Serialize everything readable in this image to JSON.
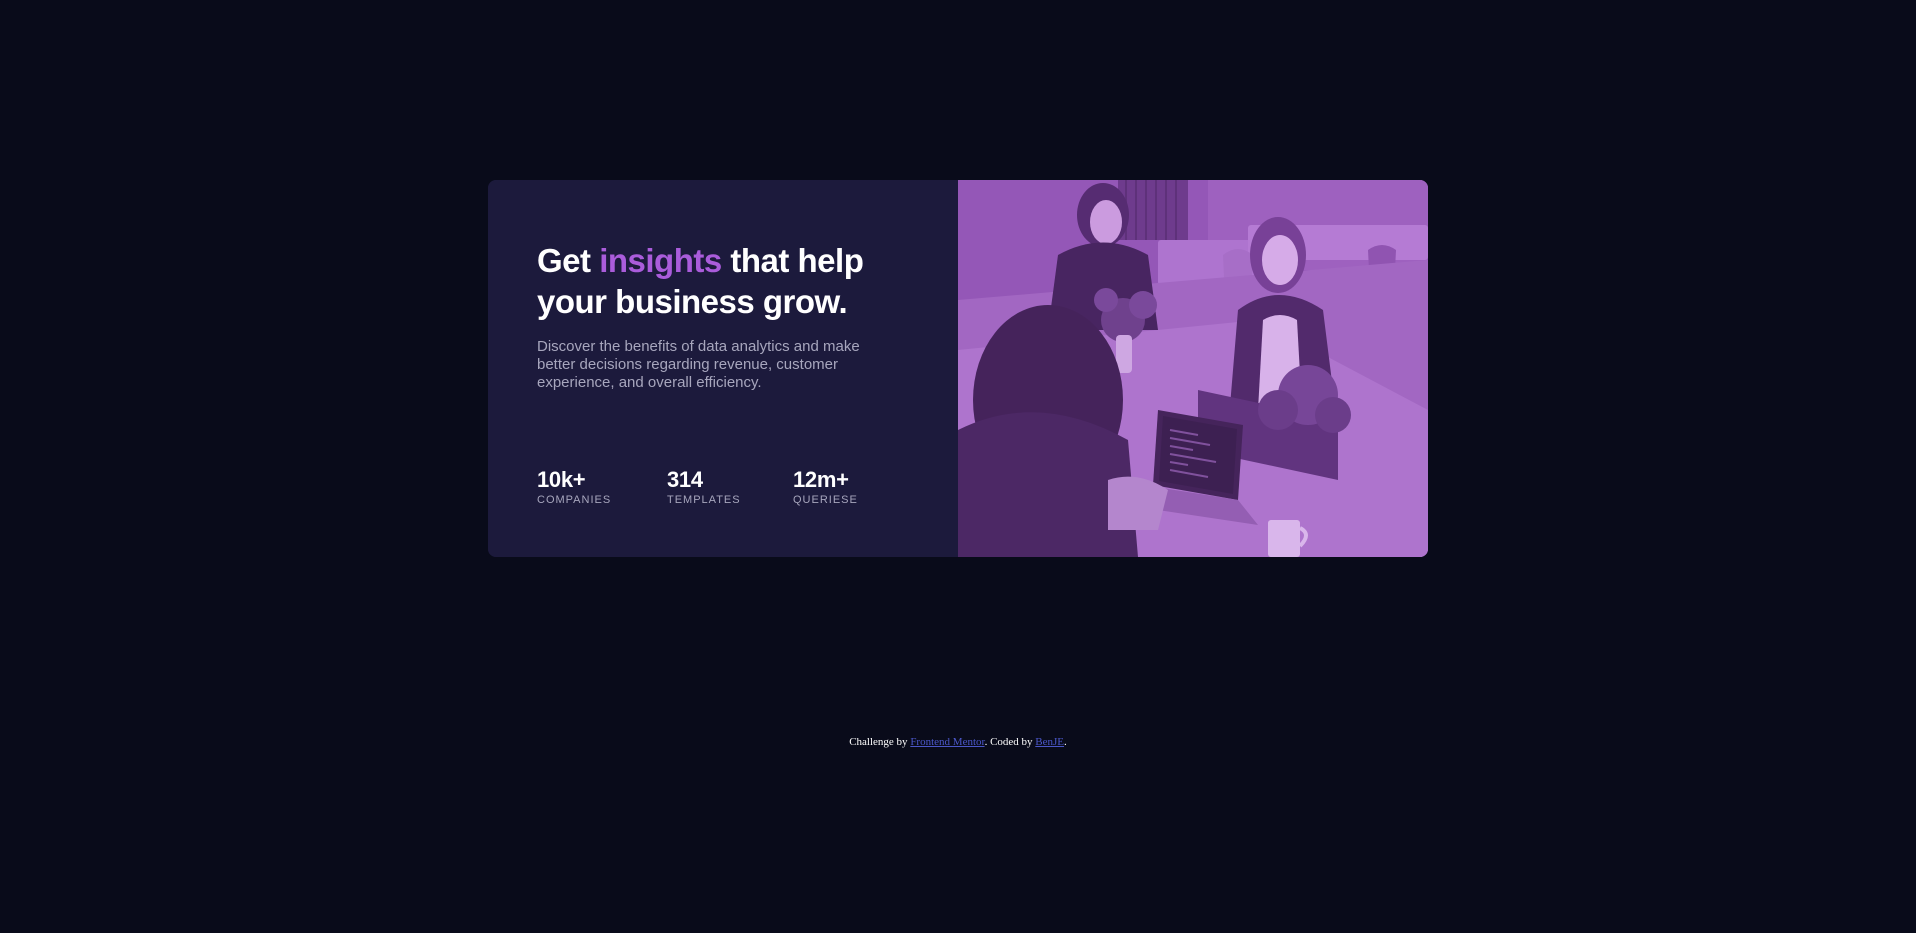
{
  "card": {
    "heading": {
      "part1": "Get ",
      "accent": "insights",
      "part2": " that help your business grow."
    },
    "description": "Discover the benefits of data analytics and make better decisions regarding revenue, customer experience, and overall efficiency.",
    "stats": [
      {
        "value": "10k+",
        "label": "COMPANIES"
      },
      {
        "value": "314",
        "label": "TEMPLATES"
      },
      {
        "value": "12m+",
        "label": "QUERIESE"
      }
    ],
    "image": {
      "icon": "office-team-photo"
    }
  },
  "attribution": {
    "prefix": "Challenge by ",
    "link1": "Frontend Mentor",
    "middle": ". Coded by ",
    "link2": "BenJE",
    "suffix": "."
  },
  "colors": {
    "page_background": "#090b1a",
    "card_background": "#1c1a3c",
    "accent": "#aa5cdb",
    "text_primary": "#ffffff",
    "text_secondary": "#a7a6bd",
    "link": "#4b57c9",
    "image_overlay": "#aa5cdb"
  }
}
